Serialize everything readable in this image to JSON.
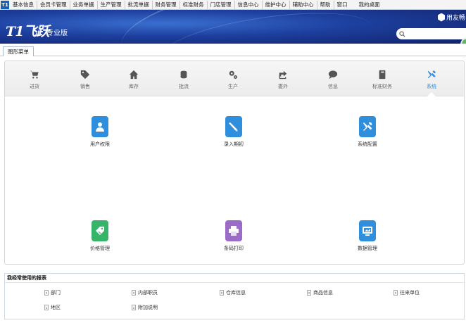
{
  "menubar": {
    "logo": "T1",
    "items": [
      "基本信息",
      "会员卡管理",
      "业务单据",
      "生产管理",
      "批流单据",
      "财务管理",
      "标准财务",
      "门店管理",
      "信息中心",
      "维护中心",
      "辅助中心",
      "帮助",
      "窗口"
    ],
    "desktop": "我的桌面"
  },
  "banner": {
    "logo": "T1飞跃",
    "edition": "专业版",
    "brand": "用友畅",
    "search_placeholder": "",
    "colors": {
      "banner_dark": "#10236a",
      "banner_light": "#3a6fd0"
    }
  },
  "tabs": [
    {
      "label": "图形菜单"
    }
  ],
  "nav": {
    "active": "系统",
    "items": [
      {
        "label": "进货",
        "icon": "cart-icon"
      },
      {
        "label": "销售",
        "icon": "tag-icon"
      },
      {
        "label": "库存",
        "icon": "home-icon"
      },
      {
        "label": "批流",
        "icon": "coins-icon"
      },
      {
        "label": "生产",
        "icon": "gears-icon"
      },
      {
        "label": "委外",
        "icon": "share-icon"
      },
      {
        "label": "信息",
        "icon": "chat-icon"
      },
      {
        "label": "标准财务",
        "icon": "book-icon"
      },
      {
        "label": "系统",
        "icon": "tools-icon"
      }
    ],
    "colors": {
      "active": "#2e8be0",
      "inactive": "#555555"
    }
  },
  "apps": [
    {
      "label": "用户权限",
      "icon": "user-icon",
      "color": "#2f8fdc"
    },
    {
      "label": "录入期初",
      "icon": "pen-icon",
      "color": "#2f8fdc"
    },
    {
      "label": "系统配置",
      "icon": "tools-icon",
      "color": "#2f8fdc"
    },
    {
      "label": "价格管理",
      "icon": "price-tag-icon",
      "color": "#36b56a"
    },
    {
      "label": "条码打印",
      "icon": "printer-icon",
      "color": "#9a6cc8"
    },
    {
      "label": "数据管理",
      "icon": "monitor-icon",
      "color": "#2f8fdc"
    }
  ],
  "reports": {
    "title": "我经常使用的报表",
    "items": [
      "部门",
      "内部职员",
      "仓库信息",
      "商品信息",
      "往来单位",
      "地区",
      "附加说明"
    ]
  }
}
